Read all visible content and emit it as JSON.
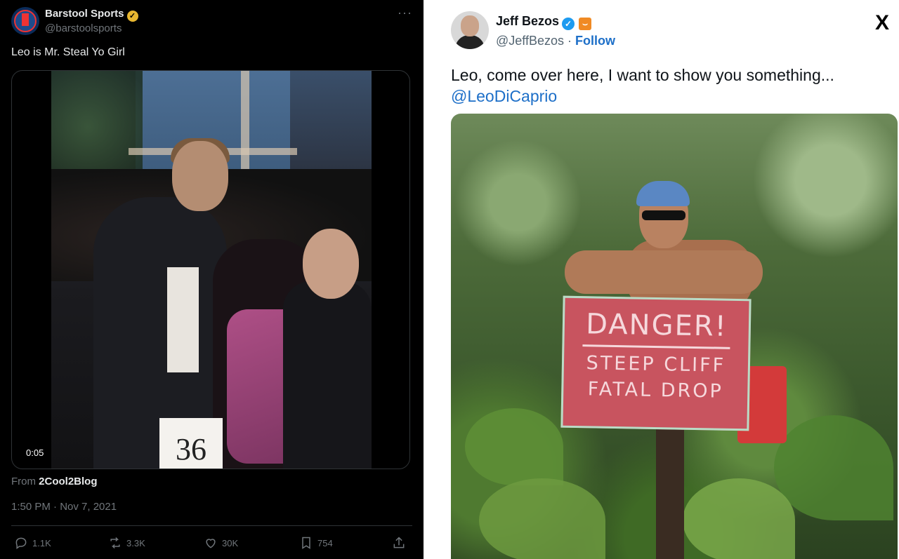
{
  "left_tweet": {
    "name": "Barstool Sports",
    "handle": "@barstoolsports",
    "more": "···",
    "text": "Leo is Mr. Steal Yo Girl",
    "video_time": "0:05",
    "card_number": "36",
    "from_label": "From",
    "from_source": "2Cool2Blog",
    "date": "1:50 PM · Nov 7, 2021",
    "actions": {
      "replies": "1.1K",
      "reposts": "3.3K",
      "likes": "30K",
      "bookmarks": "754"
    }
  },
  "right_tweet": {
    "name": "Jeff Bezos",
    "handle": "@JeffBezos",
    "separator": " · ",
    "follow": "Follow",
    "x_logo": "X",
    "text_line1": "Leo, come over here, I want to show you something...",
    "mention": "@LeoDiCaprio",
    "sign": {
      "line1": "DANGER!",
      "line2": "STEEP CLIFF",
      "line3": "FATAL DROP"
    }
  },
  "colors": {
    "dark_bg": "#000000",
    "link_blue": "#1d6fc8",
    "verified_blue": "#1d9bf0",
    "gold_badge": "#e8b730"
  }
}
